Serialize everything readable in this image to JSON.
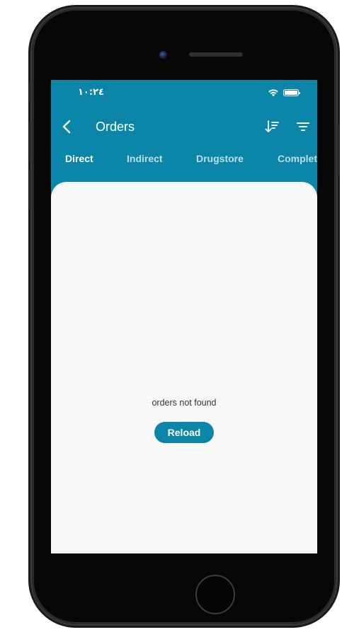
{
  "status_bar": {
    "time": "١٠:٢٤",
    "wifi_icon": "wifi-icon",
    "battery_icon": "battery-icon",
    "battery_level": 1.0
  },
  "app_bar": {
    "back_icon": "chevron-left-icon",
    "title": "Orders",
    "sort_icon": "sort-descending-icon",
    "filter_icon": "filter-icon"
  },
  "tabs": [
    {
      "label": "Direct",
      "active": true
    },
    {
      "label": "Indirect",
      "active": false
    },
    {
      "label": "Drugstore",
      "active": false
    },
    {
      "label": "Complet",
      "active": false
    }
  ],
  "content": {
    "empty_message": "orders not found",
    "reload_label": "Reload"
  },
  "colors": {
    "primary": "#0b86a8",
    "background": "#f8f8f8",
    "on_primary": "#ffffff"
  }
}
